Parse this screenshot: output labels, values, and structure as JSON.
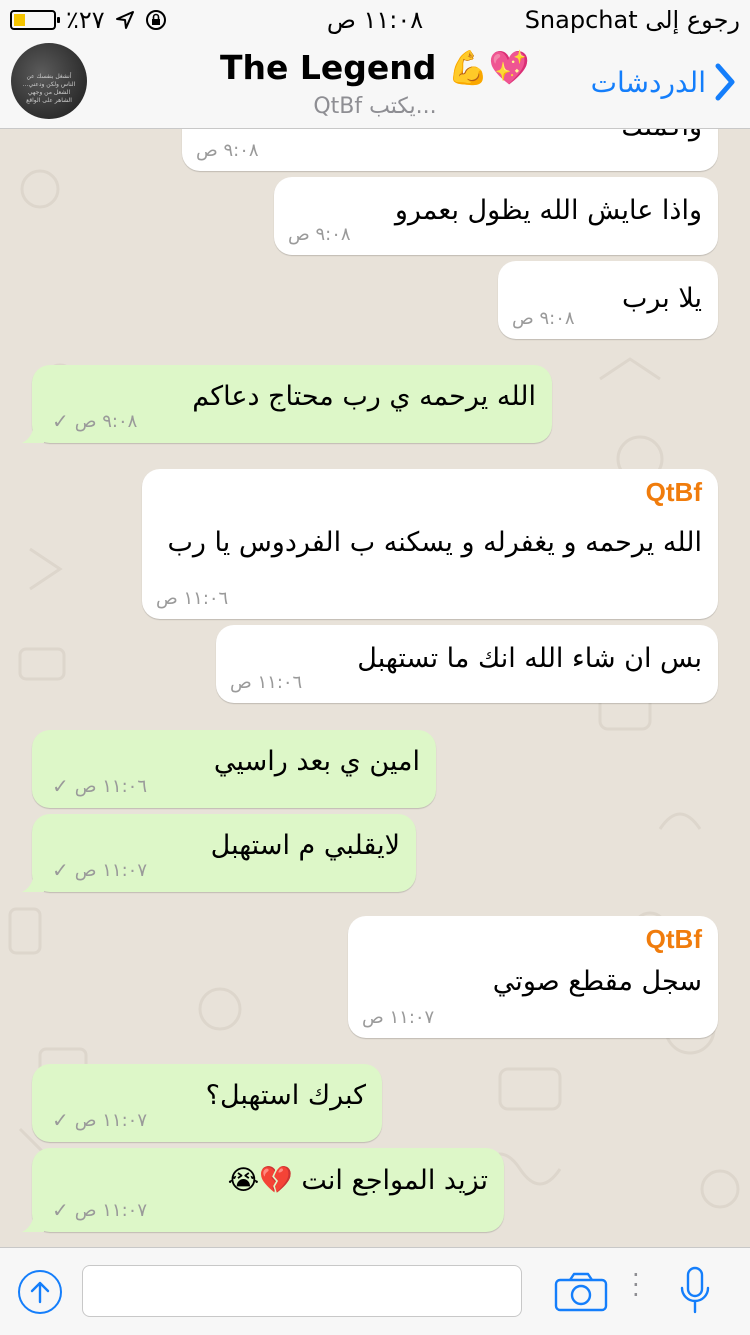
{
  "status": {
    "battery": "٪٢٧",
    "time": "١١:٠٨ ص",
    "back_app": "رجوع إلى Snapchat"
  },
  "header": {
    "title": "The Legend 💪💖",
    "subtitle": "QtBf يكتب...",
    "back_label": "الدردشات",
    "avatar_text": "أنشغل بنفسك عن الناس ولكن ودعني... الشعل من وجهي الشاهر على الواقع"
  },
  "messages": [
    {
      "dir": "in",
      "text": "واكملك",
      "time": "٩:٠٨ ص"
    },
    {
      "dir": "in",
      "text": "واذا عايش الله يظول بعمرو",
      "time": "٩:٠٨ ص"
    },
    {
      "dir": "in",
      "text": "يلا برب",
      "time": "٩:٠٨ ص"
    },
    {
      "dir": "out",
      "text": "الله يرحمه ي رب محتاج دعاكم",
      "time": "٩:٠٨ ص"
    },
    {
      "dir": "in",
      "sender": "QtBf",
      "text": "الله يرحمه و يغفرله و يسكنه ب الفردوس يا رب",
      "time": "١١:٠٦ ص"
    },
    {
      "dir": "in",
      "text": "بس ان شاء الله انك ما تستهبل",
      "time": "١١:٠٦ ص"
    },
    {
      "dir": "out",
      "text": "امين ي بعد راسيي",
      "time": "١١:٠٦ ص"
    },
    {
      "dir": "out",
      "text": "لايقلبي م استهبل",
      "time": "١١:٠٧ ص"
    },
    {
      "dir": "in",
      "sender": "QtBf",
      "text": "سجل مقطع صوتي",
      "time": "١١:٠٧ ص"
    },
    {
      "dir": "out",
      "text": "كبرك استهبل؟",
      "time": "١١:٠٧ ص"
    },
    {
      "dir": "out",
      "text": "تزيد المواجع انت 💔😭",
      "time": "١١:٠٧ ص"
    }
  ],
  "composer": {
    "placeholder": ""
  },
  "colors": {
    "accent": "#147efb",
    "outgoing_bubble": "#ddf7c8",
    "incoming_bubble": "#ffffff",
    "sender_name": "#f07c0c",
    "chat_background": "#e8e2d9"
  }
}
